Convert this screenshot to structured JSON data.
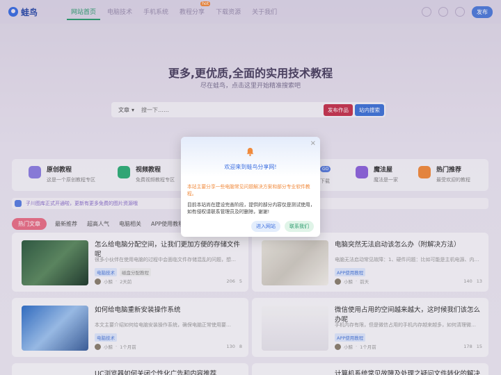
{
  "header": {
    "logo": "蛙鸟",
    "nav": [
      {
        "label": "网站首页",
        "active": true
      },
      {
        "label": "电脑技术"
      },
      {
        "label": "手机系统"
      },
      {
        "label": "教程分享",
        "badge": "hot"
      },
      {
        "label": "下载资源"
      },
      {
        "label": "关于我们"
      }
    ],
    "publish": "发布"
  },
  "hero": {
    "title": "更多,更优质,全面的实用技术教程",
    "subtitle": "尽在蛙鸟，点击这里开始精准搜索吧"
  },
  "search": {
    "type": "文章",
    "placeholder": "搜一下……",
    "publish_btn": "发布作品",
    "site_btn": "站内搜索"
  },
  "categories": [
    {
      "title": "原创教程",
      "desc": "这是一个原创教程专区",
      "color": "#8d7ee0"
    },
    {
      "title": "视频教程",
      "desc": "免费视频教程专区",
      "color": "#2fae77"
    },
    {
      "title": "魔法屋",
      "desc": "魔法是一家",
      "color": "#8d63d9"
    },
    {
      "title": "热门推荐",
      "desc": "最受欢迎的教程",
      "color": "#f08a3c"
    }
  ],
  "category_partial": {
    "badge": "GO",
    "desc": "下载"
  },
  "notice": "子川图库正式开通啦，更新有更多免费的图片资源哦",
  "tabs": [
    "热门文章",
    "最新推荐",
    "超高人气",
    "电脑相关",
    "APP使用教程"
  ],
  "articles": [
    {
      "title": "怎么给电脑分配空间，让我们更加方便的存储文件呢",
      "desc": "很多小伙伴在使用电脑的过程中会面临文件存储混乱的问题，想…",
      "tags": [
        "电脑技术",
        "磁盘分配教程"
      ],
      "author": "小鲸",
      "time": "2天前",
      "views": "206",
      "likes": "5",
      "thumb_color": "#3a6e4c"
    },
    {
      "title": "电脑突然无法启动该怎么办（附解决方法）",
      "desc": "电脑无法启动常见故障：1、硬件问题：比如可能是主机电源、内…",
      "tags": [
        "APP使用教程"
      ],
      "author": "小鲸",
      "time": "前天",
      "views": "140",
      "likes": "13",
      "thumb_color": "#e6e1d6"
    },
    {
      "title": "如何给电脑重新安装操作系统",
      "desc": "本文主要介绍如何给电脑安装操作系统，确保电脑正常使用要…",
      "tags": [
        "电脑技术"
      ],
      "author": "小鲸",
      "time": "1个月前",
      "views": "130",
      "likes": "8",
      "thumb_color": "#4d8ed8"
    },
    {
      "title": "微信使用占用的空间越来越大，这时候我们该怎么办呢",
      "desc": "手机内存有限，但是微信占用的手机内存越来越多，如何清理微…",
      "tags": [
        "APP使用教程"
      ],
      "author": "小鲸",
      "time": "1个月前",
      "views": "178",
      "likes": "15",
      "thumb_color": "#f1eff2"
    }
  ],
  "partial_articles": [
    "UC浏览器如何关闭个性化广告和内容推荐",
    "计算机系统常见故障及处理之疑问文件转化的解决办"
  ],
  "modal": {
    "title": "欢迎来到蛙鸟分享网!",
    "warning": "本站主要分享一些电脑常见问题解决方案和部分专业软件教程。",
    "body": "目前本站尚在建设完善阶段，提供的部分内容仅是测试使用，如有侵权请联系管理员及时删除，谢谢!",
    "enter_btn": "进入网站",
    "contact_btn": "联系我们",
    "close": "×"
  },
  "colors": {
    "accent": "#3b6ee0",
    "active_nav": "#2c9b6e",
    "hot_tab": "#e96f86",
    "warning": "#f08a3c"
  }
}
